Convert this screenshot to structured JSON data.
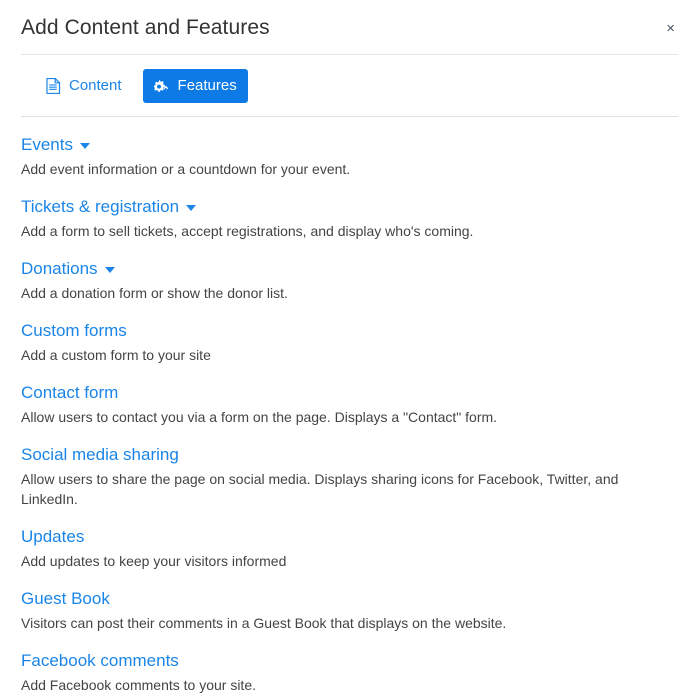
{
  "dialog": {
    "title": "Add Content and Features",
    "close_label": "×",
    "close_icon": "close-icon"
  },
  "tabs": [
    {
      "label": "Content",
      "icon": "file-document-icon",
      "active": false
    },
    {
      "label": "Features",
      "icon": "cogs-icon",
      "active": true
    }
  ],
  "features": [
    {
      "name": "Events",
      "has_dropdown": true,
      "description": "Add event information or a countdown for your event."
    },
    {
      "name": "Tickets & registration",
      "has_dropdown": true,
      "description": "Add a form to sell tickets, accept registrations, and display who's coming."
    },
    {
      "name": "Donations",
      "has_dropdown": true,
      "description": "Add a donation form or show the donor list."
    },
    {
      "name": "Custom forms",
      "has_dropdown": false,
      "description": "Add a custom form to your site"
    },
    {
      "name": "Contact form",
      "has_dropdown": false,
      "description": "Allow users to contact you via a form on the page. Displays a \"Contact\" form."
    },
    {
      "name": "Social media sharing",
      "has_dropdown": false,
      "description": "Allow users to share the page on social media. Displays sharing icons for Facebook, Twitter, and LinkedIn."
    },
    {
      "name": "Updates",
      "has_dropdown": false,
      "description": "Add updates to keep your visitors informed"
    },
    {
      "name": "Guest Book",
      "has_dropdown": false,
      "description": "Visitors can post their comments in a Guest Book that displays on the website."
    },
    {
      "name": "Facebook comments",
      "has_dropdown": false,
      "description": "Add Facebook comments to your site."
    }
  ],
  "colors": {
    "link": "#1a85e8",
    "accent": "#0d7ae5",
    "title_text": "#333333",
    "description_text": "#444444",
    "divider": "#e0e0e0"
  }
}
